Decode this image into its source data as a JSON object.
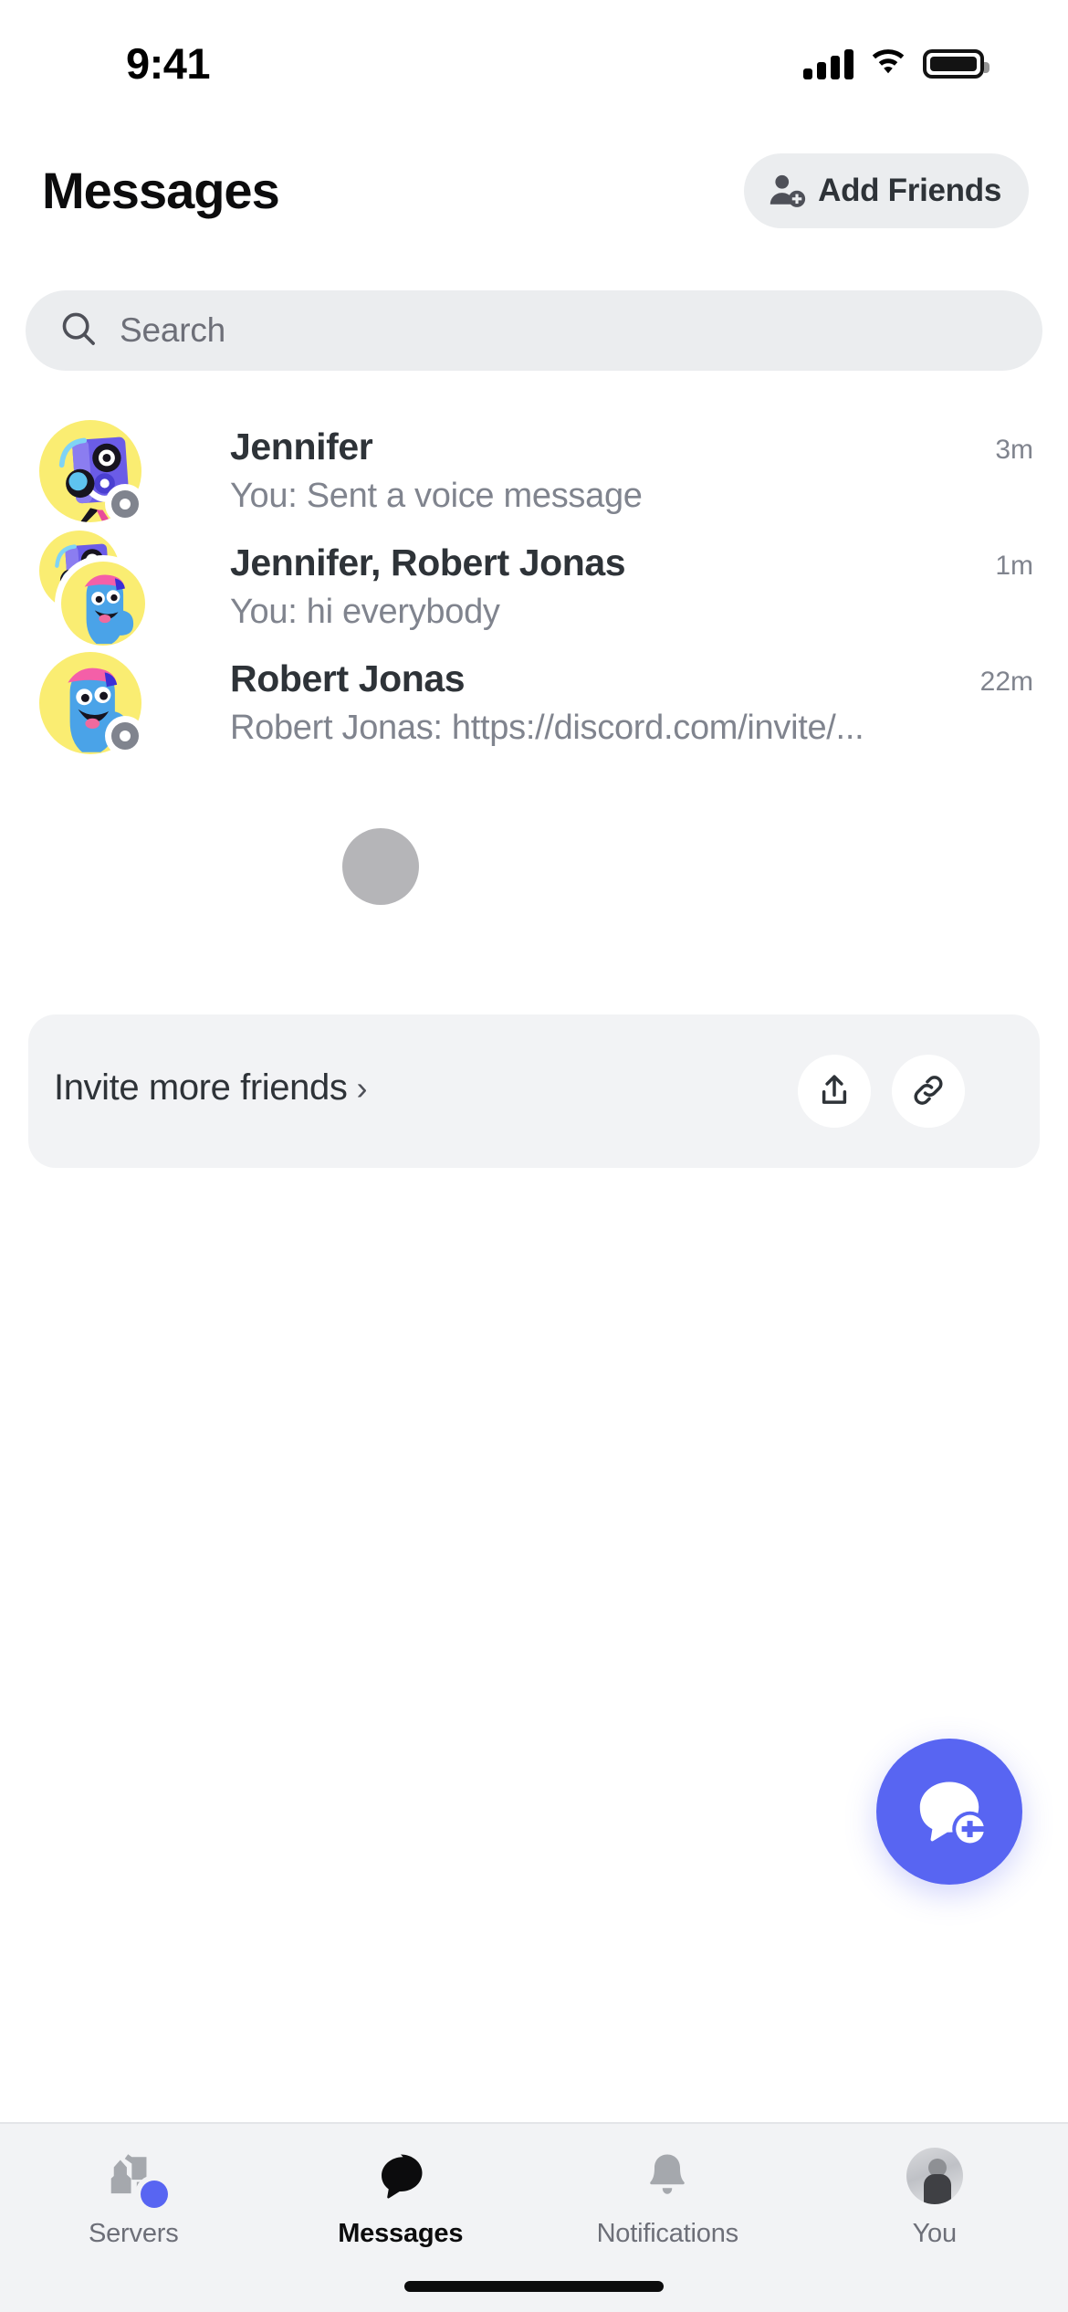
{
  "status_bar": {
    "time": "9:41",
    "cellular_icon": "cellular-bars-icon",
    "wifi_icon": "wifi-icon",
    "battery_icon": "battery-full-icon"
  },
  "header": {
    "title": "Messages",
    "add_friends_label": "Add Friends",
    "add_friends_icon": "person-add-icon"
  },
  "search": {
    "placeholder": "Search",
    "value": "",
    "icon": "search-icon"
  },
  "conversations": [
    {
      "name": "Jennifer",
      "preview": "You: Sent a voice message",
      "time": "3m",
      "type": "dm",
      "status": "offline",
      "avatar": "robot-headphones-avatar"
    },
    {
      "name": "Jennifer, Robert Jonas",
      "preview": "You: hi everybody",
      "time": "1m",
      "type": "group",
      "status": "none",
      "avatar": "robot-headphones-avatar+blue-blob-avatar"
    },
    {
      "name": "Robert Jonas",
      "preview": "Robert Jonas: https://discord.com/invite/...",
      "time": "22m",
      "type": "dm",
      "status": "offline",
      "avatar": "blue-blob-avatar"
    }
  ],
  "invite_card": {
    "label": "Invite more friends",
    "chevron": "›",
    "share_icon": "share-icon",
    "link_icon": "link-icon"
  },
  "fab": {
    "icon": "new-message-icon",
    "color": "#5865f2"
  },
  "tabs": [
    {
      "label": "Servers",
      "icon": "servers-icon",
      "active": false,
      "badge": true
    },
    {
      "label": "Messages",
      "icon": "messages-icon",
      "active": true,
      "badge": false
    },
    {
      "label": "Notifications",
      "icon": "notifications-icon",
      "active": false,
      "badge": false
    },
    {
      "label": "You",
      "icon": "profile-avatar",
      "active": false,
      "badge": false
    }
  ],
  "colors": {
    "accent": "#5865f2",
    "background": "#ffffff",
    "surface": "#f2f3f5",
    "field": "#ebedef",
    "text_primary": "#2e3338",
    "text_muted": "#80848e",
    "avatar_bg": "#faed72"
  }
}
